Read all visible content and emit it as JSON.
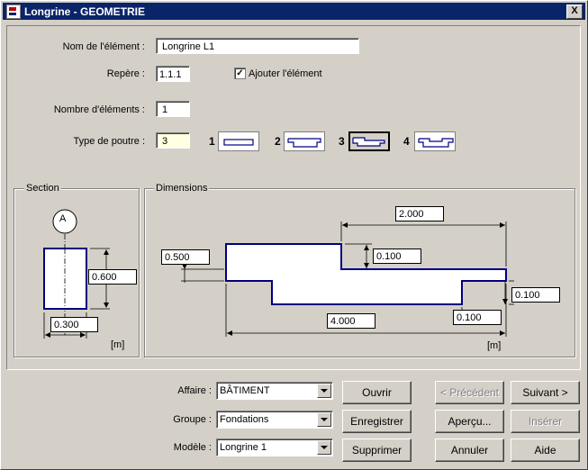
{
  "window": {
    "title": "Longrine - GEOMETRIE",
    "close_symbol": "X"
  },
  "form": {
    "name_label": "Nom de l'élément :",
    "name_value": "Longrine L1",
    "repere_label": "Repère :",
    "repere_value": "1.1.1",
    "add_element_label": "Ajouter l'élément",
    "add_element_checked": true,
    "count_label": "Nombre d'éléments :",
    "count_value": "1",
    "beam_type_label": "Type de poutre :",
    "beam_type_value": "3",
    "beam_types": [
      "1",
      "2",
      "3",
      "4"
    ],
    "selected_type": "3"
  },
  "section": {
    "title": "Section",
    "axis_label": "A",
    "height": "0.600",
    "width": "0.300",
    "unit": "[m]"
  },
  "dimensions": {
    "title": "Dimensions",
    "top_width": "2.000",
    "left_depth": "0.500",
    "step_top": "0.100",
    "right_depth": "0.100",
    "bottom_step": "0.100",
    "total_length": "4.000",
    "unit": "[m]"
  },
  "bottom": {
    "affaire_label": "Affaire :",
    "affaire_value": "BÂTIMENT",
    "groupe_label": "Groupe :",
    "groupe_value": "Fondations",
    "modele_label": "Modèle :",
    "modele_value": "Longrine 1",
    "buttons": {
      "open": "Ouvrir",
      "save": "Enregistrer",
      "delete": "Supprimer",
      "previous": "< Précédent",
      "next": "Suivant >",
      "preview": "Aperçu...",
      "insert": "Insérer",
      "cancel": "Annuler",
      "help": "Aide"
    }
  }
}
